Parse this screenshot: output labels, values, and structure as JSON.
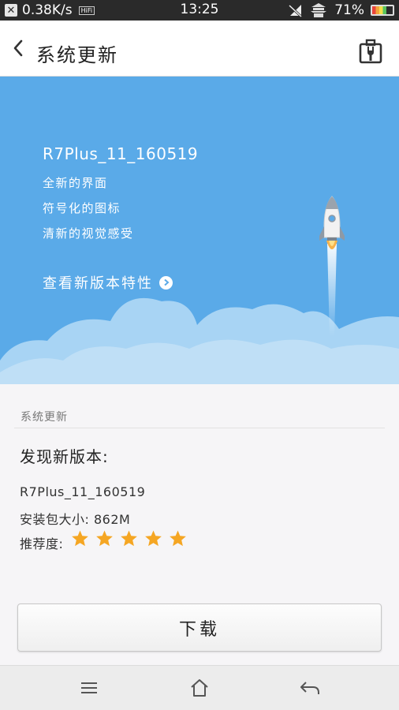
{
  "status_bar": {
    "speed": "0.38K/s",
    "hifi": "HiFi",
    "time": "13:25",
    "battery": "71%",
    "battery_level": 0.71
  },
  "header": {
    "title": "系统更新"
  },
  "banner": {
    "version": "R7Plus_11_160519",
    "features": [
      "全新的界面",
      "符号化的图标",
      "清新的视觉感受"
    ],
    "link_label": "查看新版本特性"
  },
  "details": {
    "section_label": "系统更新",
    "found_title": "发现新版本:",
    "version": "R7Plus_11_160519",
    "size": "安装包大小: 862M",
    "recommend_label": "推荐度:",
    "rating": 5,
    "rating_max": 5,
    "star_color": "#f5a623"
  },
  "download_button": {
    "label": "下载"
  },
  "icons": {
    "close": "close-icon",
    "back": "chevron-left-icon",
    "tool": "toolbox-icon",
    "link": "chevron-right-icon",
    "rocket": "rocket-icon",
    "menu": "menu-icon",
    "home": "home-icon",
    "nav_back": "back-arrow-icon"
  },
  "colors": {
    "banner": "#5aaae8",
    "cloud": "#a8d4f4"
  }
}
